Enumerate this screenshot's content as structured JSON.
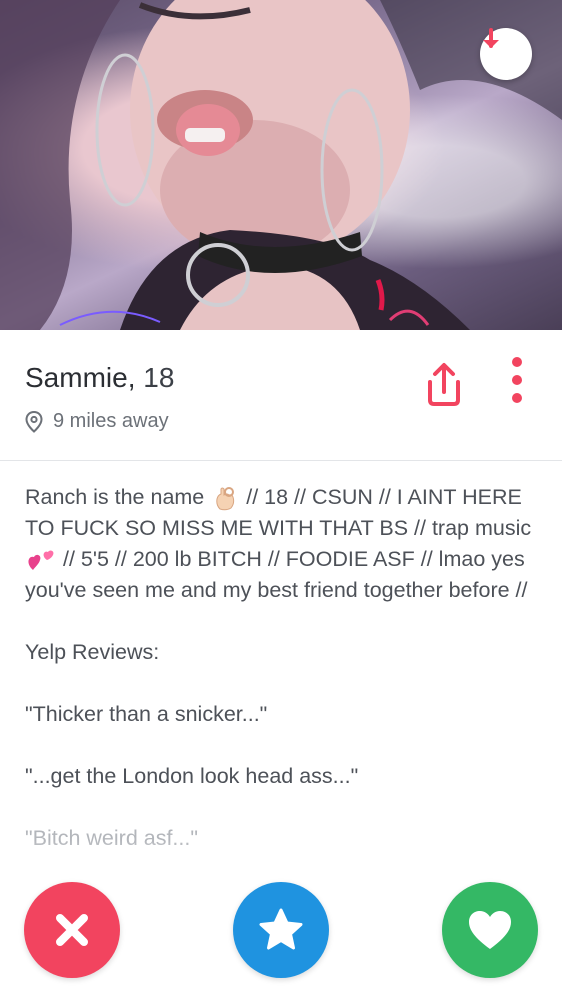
{
  "profile": {
    "name": "Sammie,",
    "age": "18",
    "distance": "9 miles away"
  },
  "bio": {
    "para1_a": "Ranch is the name",
    "para1_b": "// 18 // CSUN // I AINT HERE TO FUCK SO MISS ME WITH THAT BS // trap music",
    "para1_c": "// 5'5 // 200 lb BITCH // FOODIE ASF // lmao yes you've seen me and my best friend together before //",
    "yelp_heading": "Yelp Reviews:",
    "review1": "\"Thicker than a snicker...\"",
    "review2": "\"...get the London look head ass...\"",
    "review3": "\"Bitch weird asf...\""
  },
  "icons": {
    "down": "arrow-down-icon",
    "share": "share-icon",
    "more": "more-vertical-icon",
    "location": "location-pin-icon",
    "nope": "close-icon",
    "super_like": "star-icon",
    "like": "heart-icon"
  },
  "colors": {
    "accent": "#f2445f",
    "nope": "#f2445f",
    "super_like": "#1f93e0",
    "like": "#34b865"
  }
}
